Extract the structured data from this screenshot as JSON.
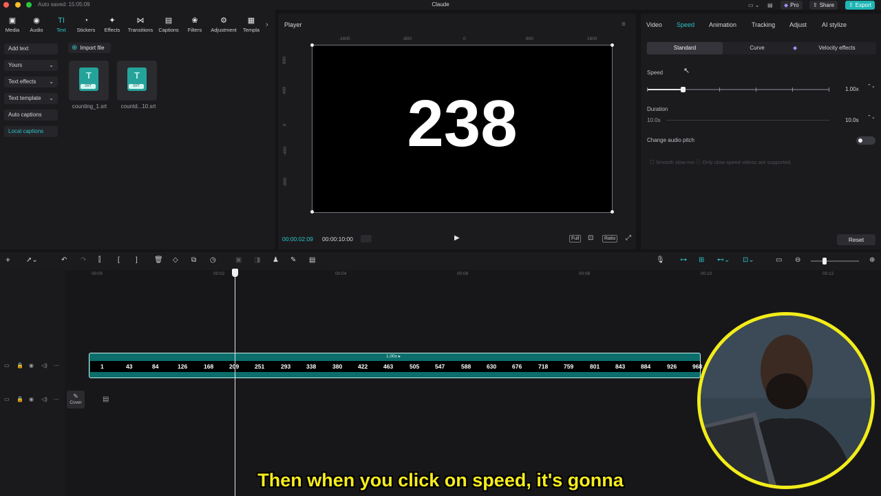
{
  "titlebar": {
    "autosaved": "Auto saved: 15:05:09",
    "app_title": "Claude",
    "pro_label": "Pro",
    "share_label": "Share",
    "export_label": "Export"
  },
  "toolbar": {
    "items": [
      {
        "label": "Media",
        "icon": "▣"
      },
      {
        "label": "Audio",
        "icon": "◉"
      },
      {
        "label": "Text",
        "icon": "TI"
      },
      {
        "label": "Stickers",
        "icon": "◔"
      },
      {
        "label": "Effects",
        "icon": "✦"
      },
      {
        "label": "Transitions",
        "icon": "⋈"
      },
      {
        "label": "Captions",
        "icon": "▤"
      },
      {
        "label": "Filters",
        "icon": "❀"
      },
      {
        "label": "Adjustment",
        "icon": "⚙"
      },
      {
        "label": "Templa",
        "icon": "▦"
      }
    ],
    "more_icon": "›"
  },
  "left_panel": {
    "categories": [
      {
        "label": "Add text",
        "chevron": ""
      },
      {
        "label": "Yours",
        "chevron": "⌄"
      },
      {
        "label": "Text effects",
        "chevron": "⌄"
      },
      {
        "label": "Text template",
        "chevron": "⌄"
      },
      {
        "label": "Auto captions",
        "chevron": ""
      },
      {
        "label": "Local captions",
        "chevron": ""
      }
    ],
    "import_label": "Import file",
    "files": [
      {
        "name": "counting_1.srt",
        "badge": "SRT",
        "glyph": "T"
      },
      {
        "name": "countd...10.srt",
        "badge": "SRT",
        "glyph": "T"
      }
    ]
  },
  "player": {
    "title": "Player",
    "menu_icon": "≡",
    "ruler_top": [
      "-1600",
      "-800",
      "0",
      "800",
      "1600"
    ],
    "ruler_left": [
      "800",
      "400",
      "0",
      "-400",
      "-800"
    ],
    "display_number": "238",
    "current_time": "00:00:02:09",
    "total_time": "00:00:10:00",
    "play_icon": "▶",
    "controls": [
      "Full",
      "⊡",
      "Ratio",
      "⤢"
    ]
  },
  "right_panel": {
    "tabs": [
      "Video",
      "Speed",
      "Animation",
      "Tracking",
      "Adjust",
      "AI stylize"
    ],
    "active_tab": "Speed",
    "segments": [
      "Standard",
      "Curve",
      "Velocity effects"
    ],
    "speed_label": "Speed",
    "speed_value": "1.00x",
    "speed_level": 0.2,
    "duration_label": "Duration",
    "duration_left": "10.0s",
    "duration_value": "10.0s",
    "audio_pitch_label": "Change audio pitch",
    "smooth_label": "Smooth slow-mo",
    "smooth_note": "Only slow-speed videos are supported.",
    "reset_label": "Reset",
    "stepper_icon": "⌃⌄"
  },
  "timeline": {
    "ruler": [
      "00:00",
      "00:02",
      "00:04",
      "00:06",
      "00:08",
      "00:10",
      "00:12"
    ],
    "clip_speed": "1.00x ▸",
    "clip_numbers": [
      "1",
      "43",
      "84",
      "126",
      "168",
      "209",
      "251",
      "293",
      "338",
      "380",
      "422",
      "463",
      "505",
      "547",
      "588",
      "630",
      "676",
      "718",
      "759",
      "801",
      "843",
      "884",
      "926",
      "968"
    ],
    "cover_label": "Cover"
  },
  "subtitle": "Then when you click on speed, it's gonna",
  "colors": {
    "accent": "#2ec4c4",
    "clip": "#0c6e6a",
    "subtitle": "#f6ec1e",
    "webcam_ring": "#f2ec1a"
  }
}
